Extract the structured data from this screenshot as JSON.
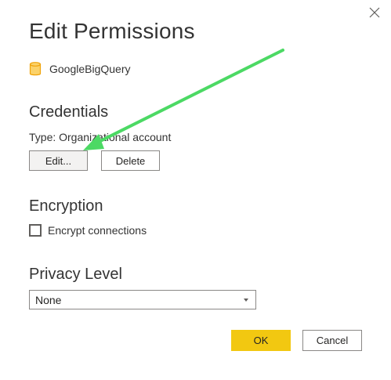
{
  "dialog": {
    "title": "Edit Permissions",
    "close_icon": "close-icon"
  },
  "data_source": {
    "icon": "database-icon",
    "name": "GoogleBigQuery"
  },
  "credentials": {
    "heading": "Credentials",
    "type_text": "Type: Organizational account",
    "edit_label": "Edit...",
    "delete_label": "Delete"
  },
  "encryption": {
    "heading": "Encryption",
    "checkbox_label": "Encrypt connections",
    "checked": false
  },
  "privacy": {
    "heading": "Privacy Level",
    "selected_value": "None"
  },
  "footer": {
    "ok_label": "OK",
    "cancel_label": "Cancel"
  },
  "colors": {
    "accent_yellow": "#f2c811",
    "annotation_green": "#4cd964",
    "database_icon": "#f0a30a",
    "text": "#333333"
  }
}
